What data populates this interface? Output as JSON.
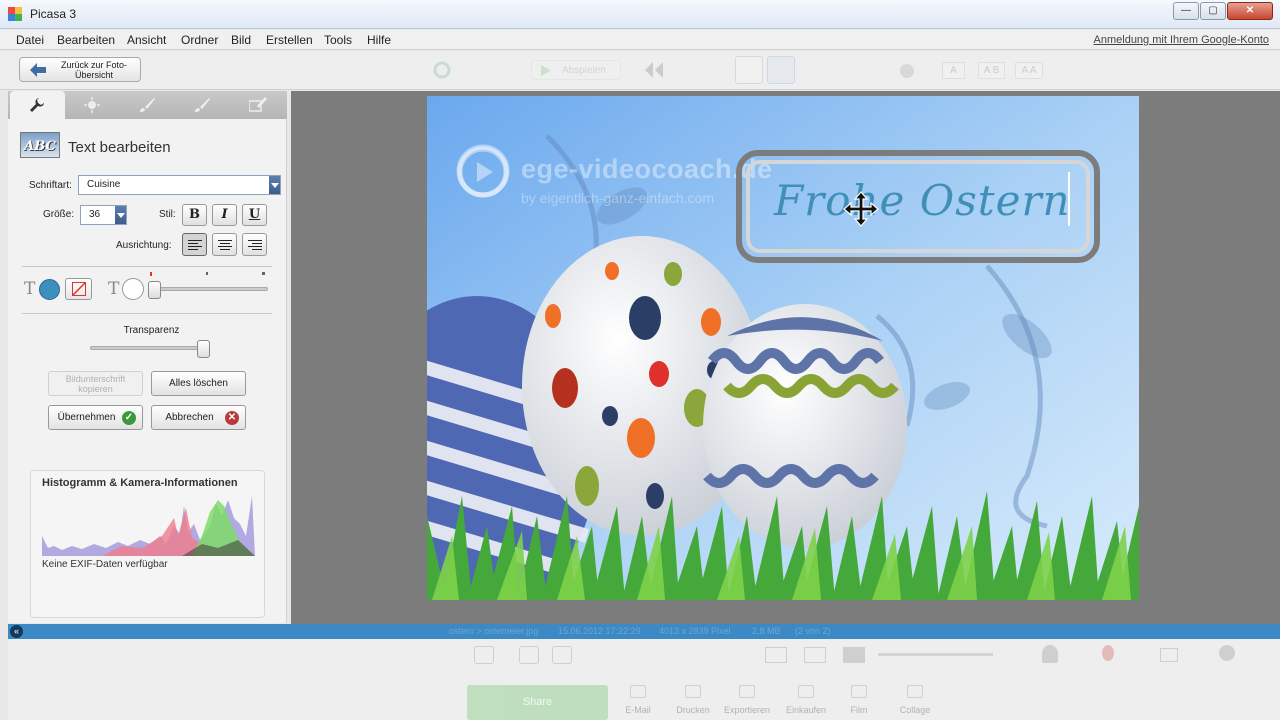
{
  "window": {
    "title": "Picasa 3",
    "controls": [
      "minimize",
      "maximize",
      "close"
    ]
  },
  "menu": {
    "items": [
      "Datei",
      "Bearbeiten",
      "Ansicht",
      "Ordner",
      "Bild",
      "Erstellen",
      "Tools",
      "Hilfe"
    ],
    "login_link": "Anmeldung mit Ihrem Google-Konto"
  },
  "toolbar": {
    "back_label": "Zurück zur Foto-Übersicht",
    "play_label": "Abspielen",
    "text_size_buttons": [
      "A",
      "A B",
      "A A"
    ]
  },
  "editor": {
    "tabs": [
      "wrench-icon",
      "sun-icon",
      "brush-icon",
      "wand-icon",
      "effects-icon"
    ],
    "section_title": "Text bearbeiten",
    "section_icon_text": "ABC",
    "font_label": "Schriftart:",
    "font_value": "Cuisine",
    "size_label": "Größe:",
    "size_value": "36",
    "style_label": "Stil:",
    "style_bold": "B",
    "style_italic": "I",
    "style_underline": "U",
    "align_label": "Ausrichtung:",
    "text_color": "#3d8fc0",
    "outline_color": "#ffffff",
    "transparency_label": "Transparenz",
    "copy_caption_button": "Bildunterschrift kopieren",
    "clear_all_button": "Alles löschen",
    "apply_button": "Übernehmen",
    "cancel_button": "Abbrechen"
  },
  "histogram": {
    "title": "Histogramm & Kamera-Informationen",
    "exif_text": "Keine EXIF-Daten verfügbar"
  },
  "photo": {
    "overlay_text": "Frohe Ostern",
    "watermark_name": "ege-videocoach.de",
    "watermark_sub": "by eigentlich-ganz-einfach.com"
  },
  "status": {
    "path": "ostern > osterneier.jpg",
    "datetime": "15.06.2012 17:22:29",
    "dimensions": "4013 x 2839 Pixel",
    "file_size": "2,8 MB",
    "position": "(2 von 2)"
  },
  "bottombar": {
    "share_label": "Share",
    "actions": [
      "E-Mail",
      "Drucken",
      "Exportieren",
      "Einkaufen",
      "Film",
      "Collage"
    ]
  }
}
